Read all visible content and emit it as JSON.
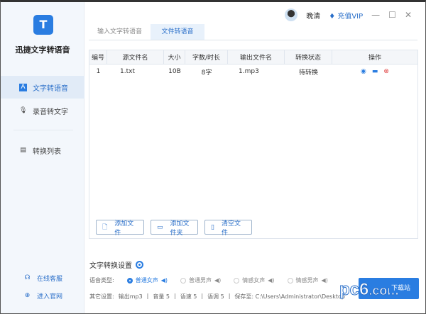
{
  "app": {
    "name": "迅捷文字转语音",
    "logo": "TJ"
  },
  "sidebar": {
    "items": [
      {
        "label": "文字转语音",
        "icon": "text-a-icon",
        "active": true
      },
      {
        "label": "录音转文字",
        "icon": "microphone-icon"
      },
      {
        "label": "转换列表",
        "icon": "list-doc-icon"
      }
    ],
    "footer": [
      {
        "label": "在线客服",
        "icon": "headset-icon"
      },
      {
        "label": "进入官网",
        "icon": "globe-icon"
      }
    ]
  },
  "header": {
    "username": "晚清",
    "vip": "充值VIP"
  },
  "tabs": [
    {
      "label": "输入文字转语音"
    },
    {
      "label": "文件转语音",
      "active": true
    }
  ],
  "table": {
    "headers": [
      "编号",
      "源文件名",
      "大小",
      "字数/时长",
      "输出文件名",
      "转换状态",
      "操作"
    ],
    "rows": [
      [
        "1",
        "1.txt",
        "10B",
        "8字",
        "1.mp3",
        "待转换"
      ]
    ]
  },
  "buttons": {
    "add_file": "添加文件",
    "add_folder": "添加文件夹",
    "clear": "清空文件"
  },
  "settings": {
    "title": "文字转换设置",
    "voice_label": "语音类型:",
    "voices": [
      "普通女声",
      "普通男声",
      "情感女声",
      "情感男声"
    ],
    "other_label": "其它设置:",
    "output": "输出mp3",
    "volume": "音量 5",
    "speed": "语速 5",
    "pitch": "语调 5",
    "save": "保存至: C:\\Users\\Administrator\\Desktop"
  },
  "watermark": {
    "text": "pc6",
    "sub": "下载站",
    "domain": ".com"
  },
  "colors": {
    "accent": "#2a7de1",
    "delete": "#e04040"
  }
}
